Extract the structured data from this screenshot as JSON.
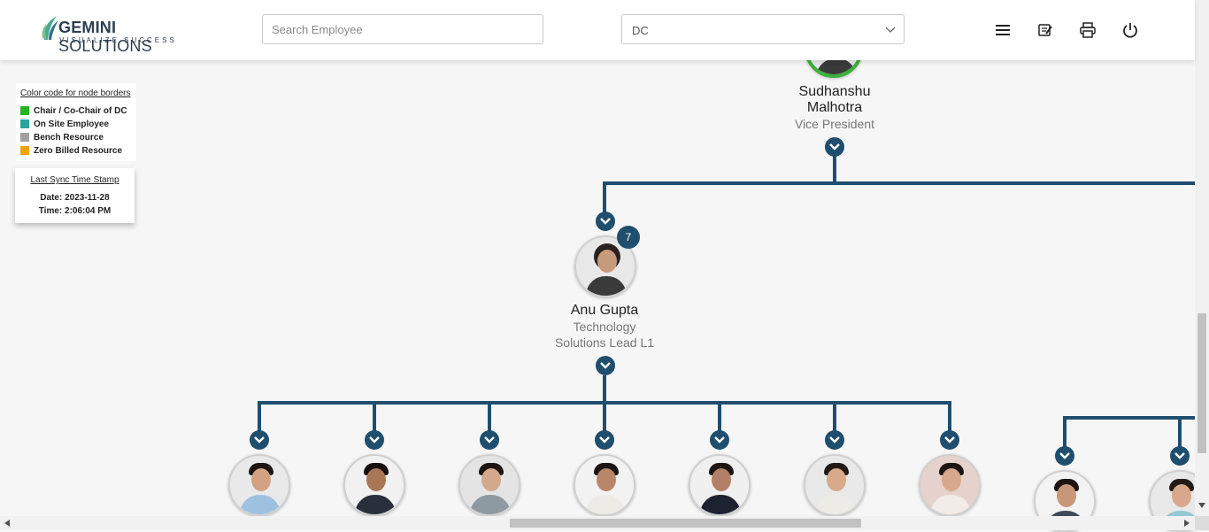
{
  "header": {
    "logo_brand_bold": "GEMINI",
    "logo_brand_rest": " SOLUTIONS",
    "logo_tagline": "VISUALIZE SUCCESS",
    "search_placeholder": "Search Employee",
    "select_value": "DC",
    "icons": [
      "menu-icon",
      "edit-note-icon",
      "print-icon",
      "power-icon"
    ]
  },
  "legend": {
    "title": "Color code for node borders",
    "items": [
      {
        "label": "Chair / Co-Chair of DC",
        "color": "#22b422"
      },
      {
        "label": "On Site Employee",
        "color": "#2aa39a"
      },
      {
        "label": "Bench Resource",
        "color": "#a0a0a0"
      },
      {
        "label": "Zero Billed Resource",
        "color": "#f2a20c"
      }
    ]
  },
  "sync": {
    "title": "Last Sync Time Stamp",
    "date": "Date: 2023-11-28",
    "time": "Time: 2:06:04 PM"
  },
  "chart": {
    "top_node": {
      "name_line1": "Sudhanshu",
      "name_line2": "Malhotra",
      "title": "Vice President"
    },
    "mid_node": {
      "name": "Anu Gupta",
      "dept": "Technology",
      "title": "Solutions Lead L1",
      "count": "7"
    },
    "connector_color": "#1f4e6e",
    "top_border_color": "#3ab03a"
  }
}
